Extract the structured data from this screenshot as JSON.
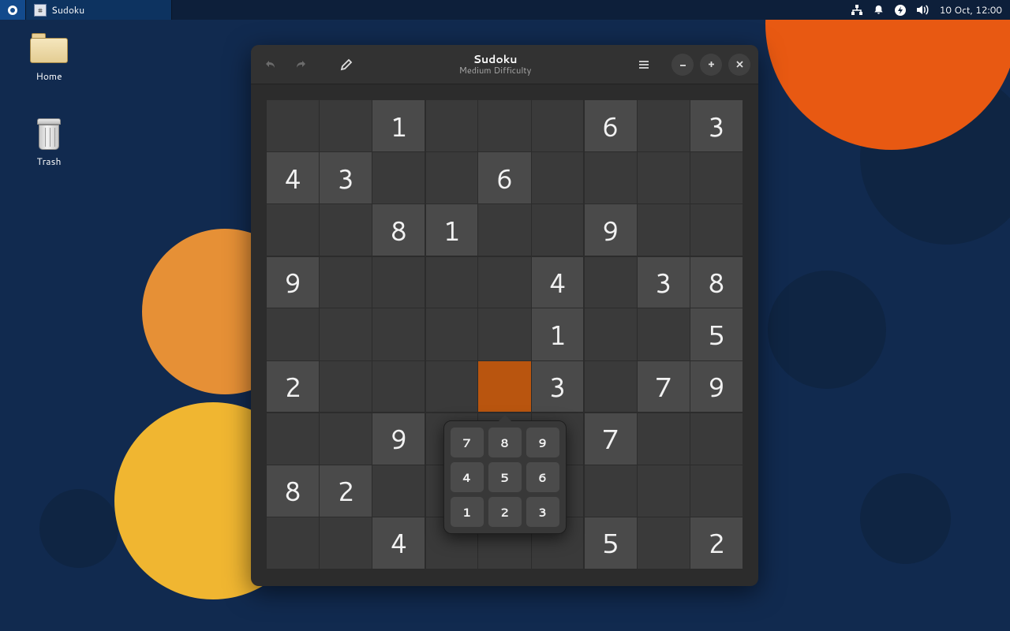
{
  "panel": {
    "app_label": "Sudoku",
    "clock": "10 Oct, 12:00"
  },
  "desktop": {
    "home": "Home",
    "trash": "Trash"
  },
  "window": {
    "title": "Sudoku",
    "subtitle": "Medium Difficulty"
  },
  "sudoku": {
    "grid": [
      [
        "",
        "",
        "1",
        "",
        "",
        "",
        "6",
        "",
        "3"
      ],
      [
        "4",
        "3",
        "",
        "",
        "6",
        "",
        "",
        "",
        ""
      ],
      [
        "",
        "",
        "8",
        "1",
        "",
        "",
        "9",
        "",
        ""
      ],
      [
        "9",
        "",
        "",
        "",
        "",
        "4",
        "",
        "3",
        "8"
      ],
      [
        "",
        "",
        "",
        "",
        "",
        "1",
        "",
        "",
        "5"
      ],
      [
        "2",
        "",
        "",
        "",
        "",
        "3",
        "",
        "7",
        "9"
      ],
      [
        "",
        "",
        "9",
        "",
        "",
        "",
        "7",
        "",
        ""
      ],
      [
        "8",
        "2",
        "",
        "",
        "",
        "",
        "",
        "",
        ""
      ],
      [
        "",
        "",
        "4",
        "",
        "",
        "",
        "5",
        "",
        "2"
      ]
    ],
    "given_mask": [
      [
        0,
        0,
        1,
        0,
        0,
        0,
        1,
        0,
        1
      ],
      [
        1,
        1,
        0,
        0,
        1,
        0,
        0,
        0,
        0
      ],
      [
        0,
        0,
        1,
        1,
        0,
        0,
        1,
        0,
        0
      ],
      [
        1,
        0,
        0,
        0,
        0,
        1,
        0,
        1,
        1
      ],
      [
        0,
        0,
        0,
        0,
        0,
        1,
        0,
        0,
        1
      ],
      [
        1,
        0,
        0,
        0,
        0,
        1,
        0,
        1,
        1
      ],
      [
        0,
        0,
        1,
        0,
        0,
        0,
        1,
        0,
        0
      ],
      [
        1,
        1,
        0,
        0,
        0,
        0,
        0,
        0,
        0
      ],
      [
        0,
        0,
        1,
        0,
        0,
        0,
        1,
        0,
        1
      ]
    ],
    "selected": {
      "row": 5,
      "col": 4
    }
  },
  "picker": {
    "numbers": [
      "7",
      "8",
      "9",
      "4",
      "5",
      "6",
      "1",
      "2",
      "3"
    ]
  }
}
